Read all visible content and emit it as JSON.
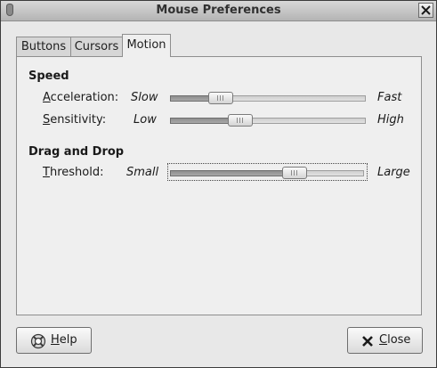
{
  "window": {
    "title": "Mouse Preferences"
  },
  "tabs": [
    {
      "label": "Buttons",
      "active": false
    },
    {
      "label": "Cursors",
      "active": false
    },
    {
      "label": "Motion",
      "active": true
    }
  ],
  "speed": {
    "heading": "Speed",
    "acceleration": {
      "label_mnemonic": "A",
      "label_rest": "cceleration:",
      "min_text": "Slow",
      "max_text": "Fast",
      "value_percent": 26
    },
    "sensitivity": {
      "label_mnemonic": "S",
      "label_rest": "ensitivity:",
      "min_text": "Low",
      "max_text": "High",
      "value_percent": 36
    }
  },
  "drag_and_drop": {
    "heading": "Drag and Drop",
    "threshold": {
      "label_mnemonic": "T",
      "label_rest": "hreshold:",
      "min_text": "Small",
      "max_text": "Large",
      "value_percent": 64
    }
  },
  "buttons": {
    "help_mnemonic": "H",
    "help_rest": "elp",
    "close_mnemonic": "C",
    "close_rest": "lose"
  },
  "icons": {
    "window_menu": "window-menu-icon",
    "window_close": "close-icon",
    "help": "help-lifebuoy-icon",
    "close": "close-x-icon"
  }
}
